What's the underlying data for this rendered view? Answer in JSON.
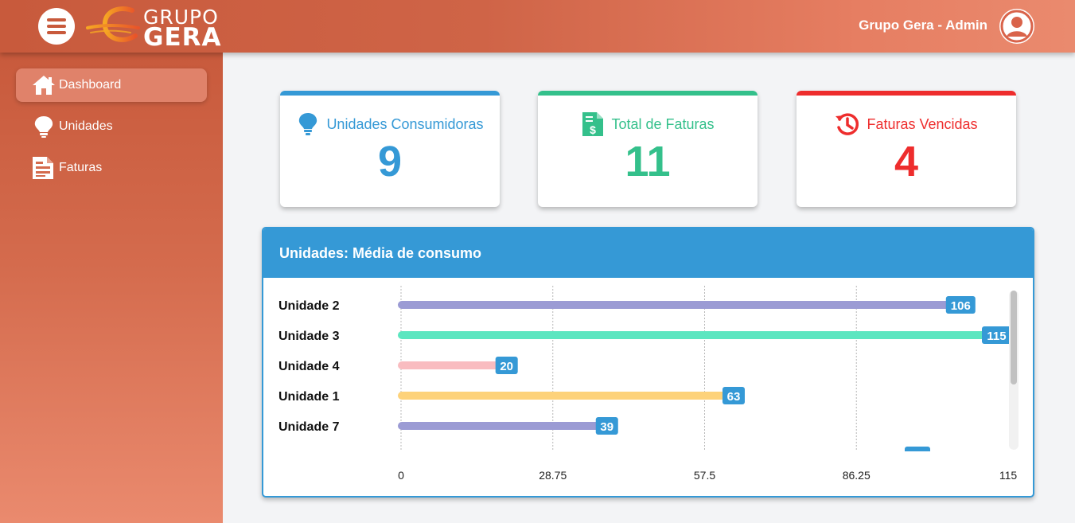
{
  "header": {
    "logo_line1": "GRUPO",
    "logo_line2": "GERA",
    "user_name": "Grupo Gera - Admin"
  },
  "sidebar": {
    "items": [
      {
        "label": "Dashboard",
        "icon": "home-icon",
        "active": true
      },
      {
        "label": "Unidades",
        "icon": "lightbulb-icon",
        "active": false
      },
      {
        "label": "Faturas",
        "icon": "invoice-icon",
        "active": false
      }
    ]
  },
  "cards": [
    {
      "title": "Unidades Consumidoras",
      "value": "9",
      "color": "#3599d6",
      "icon": "lightbulb-icon"
    },
    {
      "title": "Total de Faturas",
      "value": "11",
      "color": "#34c08b",
      "icon": "invoice-dollar-icon"
    },
    {
      "title": "Faturas Vencidas",
      "value": "4",
      "color": "#ee2d2d",
      "icon": "history-icon"
    }
  ],
  "panel": {
    "title": "Unidades: Média de consumo"
  },
  "chart_data": {
    "type": "bar",
    "orientation": "horizontal",
    "categories": [
      "Unidade 2",
      "Unidade 3",
      "Unidade 4",
      "Unidade 1",
      "Unidade 7"
    ],
    "values": [
      106,
      115,
      20,
      63,
      39
    ],
    "colors": [
      "#9b9bd4",
      "#5ce6c0",
      "#f9bcc0",
      "#fdd27a",
      "#9b9bd4"
    ],
    "label_color": "#3599d6",
    "xlim": [
      0,
      115
    ],
    "xticks": [
      "0",
      "28.75",
      "57.5",
      "86.25",
      "115"
    ],
    "grid": true,
    "legend": "none"
  }
}
